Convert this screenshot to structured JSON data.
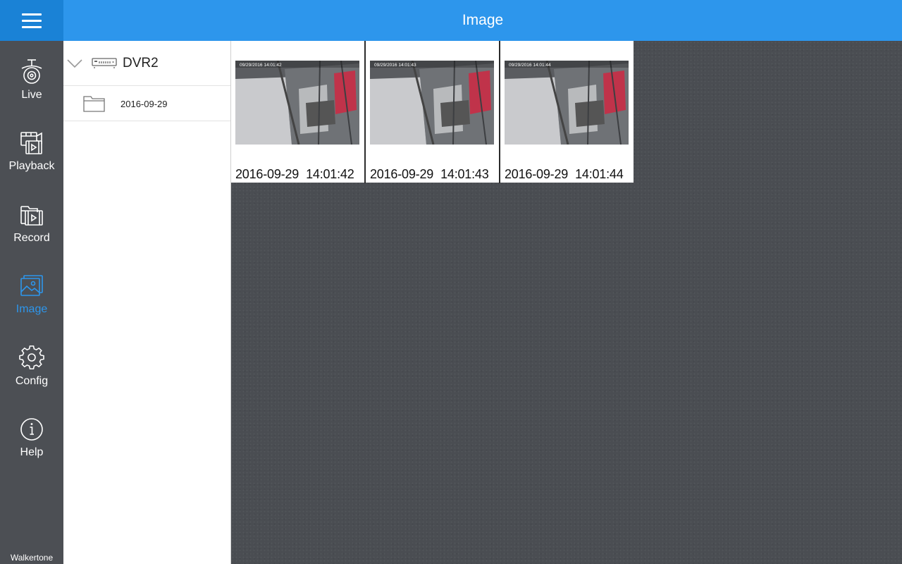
{
  "header": {
    "title": "Image",
    "menu_icon": "hamburger-menu-icon"
  },
  "sidebar": {
    "items": [
      {
        "label": "Live",
        "icon": "camera-icon",
        "active": false
      },
      {
        "label": "Playback",
        "icon": "playback-film-icon",
        "active": false
      },
      {
        "label": "Record",
        "icon": "record-folder-icon",
        "active": false
      },
      {
        "label": "Image",
        "icon": "image-gallery-icon",
        "active": true
      },
      {
        "label": "Config",
        "icon": "gear-icon",
        "active": false
      },
      {
        "label": "Help",
        "icon": "info-icon",
        "active": false
      }
    ],
    "brand": "Walkertone"
  },
  "tree": {
    "root": {
      "name": "DVR2",
      "expanded": true
    },
    "children": [
      {
        "name": "2016-09-29"
      }
    ]
  },
  "thumbnails": [
    {
      "date": "2016-09-29",
      "time": "14:01:42",
      "overlay_text": "09/29/2016 14:01:42"
    },
    {
      "date": "2016-09-29",
      "time": "14:01:43",
      "overlay_text": "09/29/2016 14:01:43"
    },
    {
      "date": "2016-09-29",
      "time": "14:01:44",
      "overlay_text": "09/29/2016 14:01:44"
    }
  ],
  "colors": {
    "accent": "#2d96ec",
    "menu_button": "#1a82d6",
    "sidebar_bg": "#4c4f54",
    "content_bg": "#4a4d52"
  }
}
